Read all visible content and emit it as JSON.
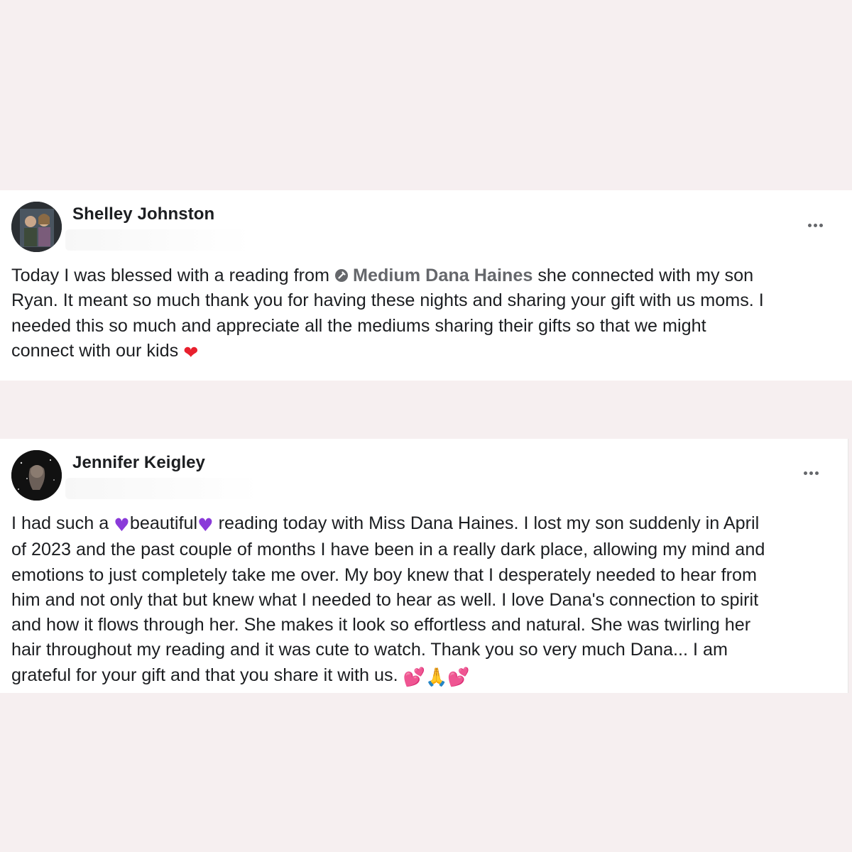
{
  "posts": [
    {
      "author": "Shelley Johnston",
      "mention_icon": "verified-page-icon",
      "lines": {
        "l1_before": "Today I was blessed with a reading from ",
        "l1_mention": "Medium Dana Haines",
        "l1_after": " she connected with my son",
        "l2": "Ryan. It meant so much thank you for having these nights and sharing your gift with us moms. I",
        "l3": "needed this so much and appreciate all the mediums sharing their gifts so that we might",
        "l4": "connect with our kids "
      },
      "emoji": {
        "heart": "❤"
      },
      "emoji_colors": {
        "heart": "#e8202e"
      }
    },
    {
      "author": "Jennifer Keigley",
      "lines": {
        "l1_a": "I had such a ",
        "l1_b": "beautiful",
        "l1_c": " reading today with Miss Dana Haines. I lost my son suddenly in April",
        "l2": "of 2023 and the past couple of months I have been in a really dark place, allowing my mind and",
        "l3": "emotions to just completely take me over. My boy knew that I desperately needed to hear from",
        "l4": "him and not only that but knew what I needed to hear as well. I love Dana's connection to spirit",
        "l5": "and how it flows through her. She makes it look so effortless and natural. She was twirling her",
        "l6": "hair throughout my reading and it was cute to watch. Thank you so very much Dana... I am",
        "l7": "grateful for your gift and that you share it with us. "
      },
      "emoji": {
        "purple_heart": "♥",
        "two_hearts": "💕",
        "folded_hands": "🙏"
      },
      "emoji_colors": {
        "purple_heart": "#8a3ad9",
        "two_hearts": "#e8336b",
        "folded_hands": "#f0b429"
      }
    }
  ],
  "more_icon": "more-options-icon"
}
